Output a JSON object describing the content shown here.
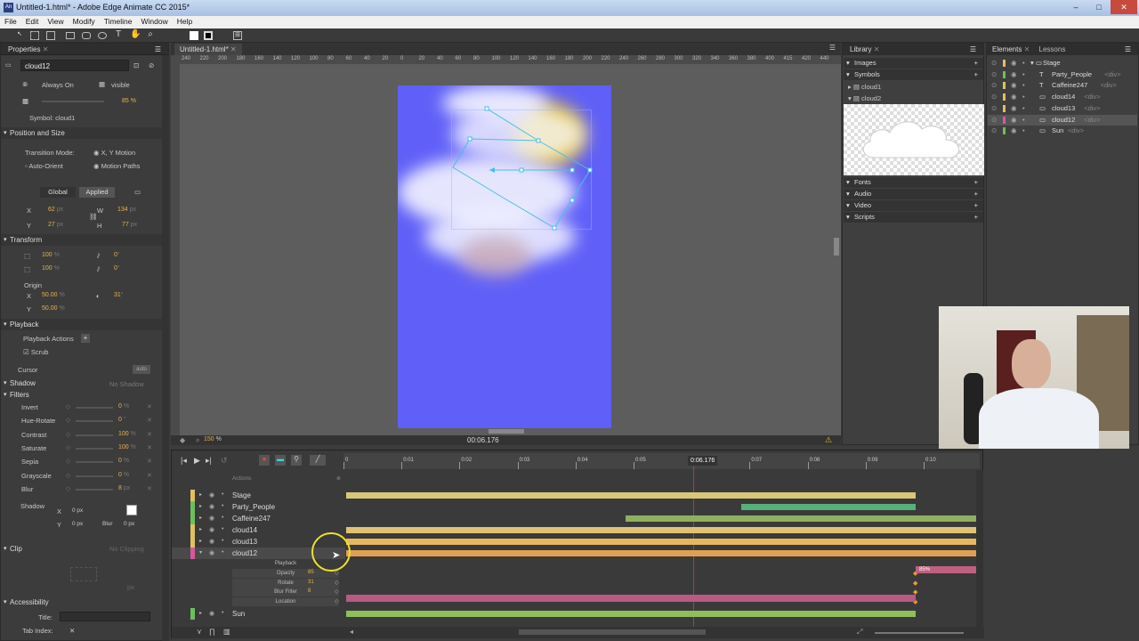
{
  "window": {
    "title": "Untitled-1.html* - Adobe Edge Animate CC 2015*",
    "app_icon": "An",
    "buttons": [
      "–",
      "□",
      "✕"
    ]
  },
  "menu": [
    "File",
    "Edit",
    "View",
    "Modify",
    "Timeline",
    "Window",
    "Help"
  ],
  "properties": {
    "tab": "Properties",
    "element_name": "cloud12",
    "always_on": "Always On",
    "visible": "visible",
    "opacity": "85",
    "opacity_unit": "%",
    "symbol": "Symbol: cloud1",
    "position_size": "Position and Size",
    "transition_mode_label": "Transition Mode:",
    "transition_mode": "X, Y Motion",
    "auto_orient": "Auto-Orient",
    "motion_paths": "Motion Paths",
    "global": "Global",
    "applied": "Applied",
    "x_label": "X",
    "x": "62",
    "x_unit": "px",
    "y_label": "Y",
    "y": "27",
    "y_unit": "px",
    "w_label": "W",
    "w": "134",
    "w_unit": "px",
    "h_label": "H",
    "h": "77",
    "h_unit": "px",
    "transform": "Transform",
    "scale_x": "100",
    "scale_y": "100",
    "pct": "%",
    "skew_x": "0",
    "skew_y": "0",
    "deg": "°",
    "origin": "Origin",
    "origin_x_label": "X",
    "origin_x": "50.00",
    "origin_y_label": "Y",
    "origin_y": "50.00",
    "rotate": "31",
    "playback": "Playback",
    "playback_actions": "Playback Actions",
    "scrub": "Scrub",
    "cursor": "Cursor",
    "cursor_value": "auto",
    "shadow": "Shadow",
    "no_shadow": "No Shadow",
    "filters": "Filters",
    "filter_items": [
      {
        "name": "Invert",
        "value": "0",
        "unit": "%"
      },
      {
        "name": "Hue-Rotate",
        "value": "0",
        "unit": "°"
      },
      {
        "name": "Contrast",
        "value": "100",
        "unit": "%"
      },
      {
        "name": "Saturate",
        "value": "100",
        "unit": "%"
      },
      {
        "name": "Sepia",
        "value": "0",
        "unit": "%"
      },
      {
        "name": "Grayscale",
        "value": "0",
        "unit": "%"
      },
      {
        "name": "Blur",
        "value": "8",
        "unit": "px"
      }
    ],
    "filter_shadow": "Shadow",
    "fs_x_label": "X",
    "fs_x": "0 px",
    "fs_y_label": "Y",
    "fs_y": "0 px",
    "fs_blur_label": "Blur",
    "fs_blur": "0 px",
    "clip": "Clip",
    "no_clipping": "No Clipping",
    "clip_px": "px",
    "accessibility": "Accessibility",
    "title_label": "Title:",
    "tab_index_label": "Tab Index:"
  },
  "document": {
    "tab": "Untitled-1.html*",
    "ruler_labels": [
      "240",
      "220",
      "200",
      "180",
      "160",
      "140",
      "120",
      "100",
      "80",
      "60",
      "40",
      "20",
      "0",
      "20",
      "40",
      "60",
      "80",
      "100",
      "120",
      "140",
      "160",
      "180",
      "200",
      "220",
      "240",
      "260",
      "280",
      "300",
      "320",
      "340",
      "360",
      "380",
      "400",
      "415",
      "420",
      "440"
    ],
    "zoom": "150",
    "zoom_unit": "%",
    "time": "00:06.176"
  },
  "timeline": {
    "playhead_time": "0:06.176",
    "ticks": [
      "0",
      "0:01",
      "0:02",
      "0:03",
      "0:04",
      "0:05",
      "0:07",
      "0:08",
      "0:09",
      "0:10"
    ],
    "actions_label": "Actions",
    "rows": [
      {
        "name": "Stage",
        "color": "#e0c060"
      },
      {
        "name": "Party_People",
        "color": "#6cbf5a"
      },
      {
        "name": "Caffeine247",
        "color": "#6cbf5a"
      },
      {
        "name": "cloud14",
        "color": "#e0c060"
      },
      {
        "name": "cloud13",
        "color": "#e0c060"
      },
      {
        "name": "cloud12",
        "color": "#d45a9a"
      },
      {
        "name": "Sun",
        "color": "#6cbf5a"
      }
    ],
    "sub_rows": [
      "Playback",
      "Opacity",
      "Rotate",
      "Blur Filter",
      "Location"
    ],
    "sub_values": [
      "",
      "85",
      "31",
      "8",
      ""
    ],
    "opacity_key_label": "85%"
  },
  "library": {
    "tab": "Library",
    "sections": [
      "Images",
      "Symbols",
      "Fonts",
      "Audio",
      "Video",
      "Scripts"
    ],
    "symbols": [
      "cloud1",
      "cloud2"
    ]
  },
  "elements": {
    "tabs": [
      "Elements",
      "Lessons"
    ],
    "items": [
      {
        "name": "Stage",
        "tag": "",
        "color": "#e0c060"
      },
      {
        "name": "Party_People",
        "tag": "<div>",
        "color": "#6cbf5a"
      },
      {
        "name": "Caffeine247",
        "tag": "<div>",
        "color": "#e0c060"
      },
      {
        "name": "cloud14",
        "tag": "<div>",
        "color": "#e0c060"
      },
      {
        "name": "cloud13",
        "tag": "<div>",
        "color": "#e0c060"
      },
      {
        "name": "cloud12",
        "tag": "<div>",
        "color": "#d45a9a"
      },
      {
        "name": "Sun",
        "tag": "<div>",
        "color": "#6cbf5a"
      }
    ]
  }
}
